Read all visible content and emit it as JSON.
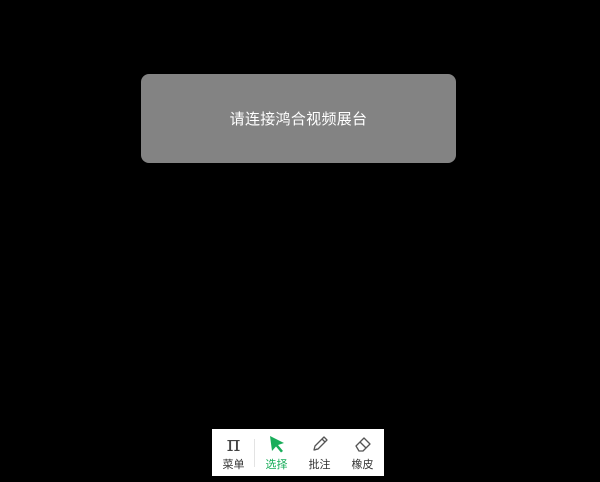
{
  "notice": {
    "message": "请连接鸿合视频展台"
  },
  "toolbar": {
    "items": [
      {
        "label": "菜单",
        "icon": "pi-icon"
      },
      {
        "label": "选择",
        "icon": "cursor-arrow-icon",
        "active": true
      },
      {
        "label": "批注",
        "icon": "pencil-icon"
      },
      {
        "label": "橡皮",
        "icon": "eraser-icon"
      }
    ],
    "active_color": "#19ad5a"
  },
  "colors": {
    "background": "#000000",
    "notice_background": "#838383",
    "toolbar_background": "#ffffff"
  }
}
